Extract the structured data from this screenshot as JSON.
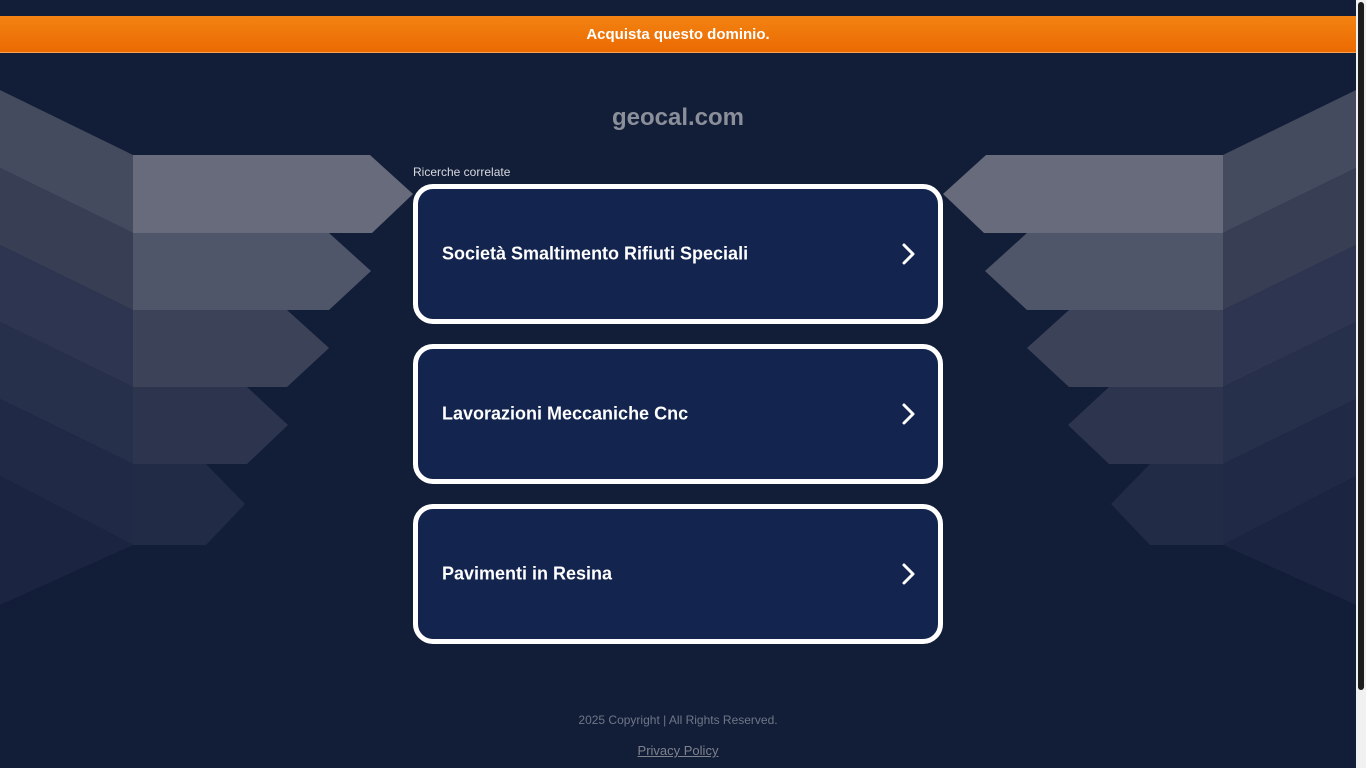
{
  "banner": {
    "label": "Acquista questo dominio."
  },
  "domain": {
    "name": "geocal.com"
  },
  "related": {
    "label": "Ricerche correlate",
    "items": [
      {
        "label": "Società Smaltimento Rifiuti Speciali"
      },
      {
        "label": "Lavorazioni Meccaniche Cnc"
      },
      {
        "label": "Pavimenti in Resina"
      }
    ]
  },
  "footer": {
    "copyright": "2025 Copyright | All Rights Reserved.",
    "privacy_label": "Privacy Policy"
  },
  "colors": {
    "background": "#121d38",
    "banner": "#f07a08",
    "card": "#13244e",
    "card_border": "#ffffff"
  },
  "icons": {
    "card_arrow": "chevron-right-icon"
  }
}
